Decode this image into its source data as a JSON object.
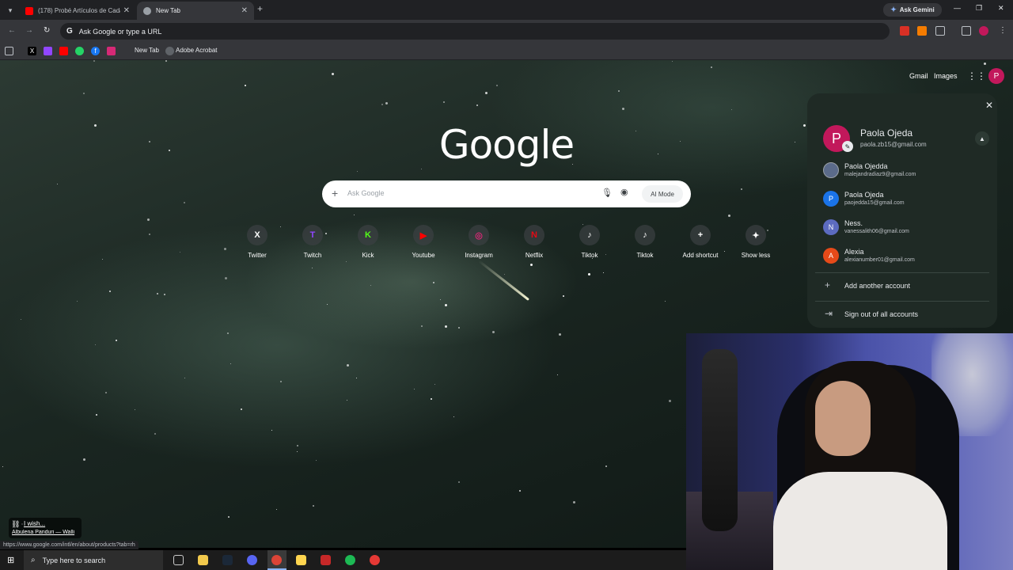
{
  "browser": {
    "tabs": [
      {
        "title": "(178) Probé Artículos de Cada I",
        "active": false,
        "favicon": "youtube-icon"
      },
      {
        "title": "New Tab",
        "active": true,
        "favicon": "chrome-icon"
      }
    ],
    "ask_gemini": "Ask Gemini",
    "omnibox_placeholder": "Ask Google or type a URL",
    "bookmarks": {
      "new_tab": "New Tab",
      "adobe": "Adobe Acrobat"
    }
  },
  "page": {
    "top_links": {
      "gmail": "Gmail",
      "images": "Images"
    },
    "avatar_initial": "P",
    "logo": "Google",
    "search_placeholder": "Ask Google",
    "ai_mode": "AI Mode",
    "shortcuts": [
      {
        "label": "Twitter",
        "glyph": "X",
        "color": "#000000"
      },
      {
        "label": "Twitch",
        "glyph": "T",
        "color": "#9146ff"
      },
      {
        "label": "Kick",
        "glyph": "K",
        "color": "#53fc18"
      },
      {
        "label": "Youtube",
        "glyph": "▶",
        "color": "#ff0000"
      },
      {
        "label": "Instagram",
        "glyph": "◎",
        "color": "#d62976"
      },
      {
        "label": "Netflix",
        "glyph": "N",
        "color": "#e50914"
      },
      {
        "label": "Tiktok",
        "glyph": "♪",
        "color": "#111111"
      },
      {
        "label": "Tiktok",
        "glyph": "♪",
        "color": "#111111"
      },
      {
        "label": "Add shortcut",
        "glyph": "+",
        "color": "#3c4043"
      },
      {
        "label": "Show less",
        "glyph": "✦",
        "color": "#3c4043"
      }
    ]
  },
  "account": {
    "name": "Paola Ojeda",
    "email": "paola.zb15@gmail.com",
    "initial": "P",
    "others": [
      {
        "name": "Paola Ojedda",
        "email": "malejandradiaz9@gmail.com",
        "initial": "",
        "color": "#5b6b8a"
      },
      {
        "name": "Paola Ojeda",
        "email": "paojedda15@gmail.com",
        "initial": "P",
        "color": "#1a73e8"
      },
      {
        "name": "Ness.",
        "email": "vanessalith06@gmail.com",
        "initial": "N",
        "color": "#5c6bc0"
      },
      {
        "name": "Alexia",
        "email": "alexianumber01@gmail.com",
        "initial": "A",
        "color": "#e64a19"
      }
    ],
    "add_account": "Add another account",
    "sign_out": "Sign out of all accounts"
  },
  "overlay": {
    "song_title": "I wish...",
    "song_artist": "Albulena Panduri — Walli",
    "status_url": "https://www.google.com/intl/en/about/products?tab=rh"
  },
  "taskbar": {
    "search_placeholder": "Type here to search"
  }
}
